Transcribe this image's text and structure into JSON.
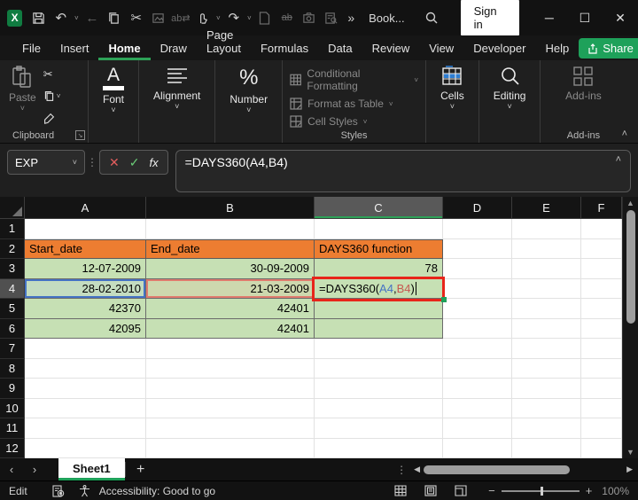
{
  "titlebar": {
    "title": "Book...",
    "sign_in": "Sign in",
    "overflow": "»"
  },
  "tabs": {
    "items": [
      "File",
      "Insert",
      "Home",
      "Draw",
      "Page Layout",
      "Formulas",
      "Data",
      "Review",
      "View",
      "Developer",
      "Help"
    ],
    "active": "Home",
    "share": "Share"
  },
  "ribbon": {
    "paste": "Paste",
    "clipboard_label": "Clipboard",
    "font_label": "Font",
    "alignment_label": "Alignment",
    "number_label": "Number",
    "conditional_formatting": "Conditional Formatting",
    "format_as_table": "Format as Table",
    "cell_styles": "Cell Styles",
    "styles_label": "Styles",
    "cells_label": "Cells",
    "editing_label": "Editing",
    "addins_button": "Add-ins",
    "addins_label": "Add-ins"
  },
  "formula_bar": {
    "name_box": "EXP",
    "formula": "=DAYS360(A4,B4)",
    "fx": "fx"
  },
  "grid": {
    "col_headers": [
      "A",
      "B",
      "C",
      "D",
      "E",
      "F"
    ],
    "row_headers": [
      "1",
      "2",
      "3",
      "4",
      "5",
      "6",
      "7",
      "8",
      "9",
      "10",
      "11",
      "12"
    ],
    "cells": {
      "a2": "Start_date",
      "b2": "End_date",
      "c2": "DAYS360 function",
      "a3": "12-07-2009",
      "b3": "30-09-2009",
      "c3": "78",
      "a4": "28-02-2010",
      "b4": "21-03-2009",
      "a5": "42370",
      "b5": "42401",
      "a6": "42095",
      "b6": "42401"
    },
    "formula_parts": {
      "fn": "=DAYS360(",
      "ref1": "A4",
      "sep": ",",
      "ref2": "B4",
      "close": ")"
    }
  },
  "sheetbar": {
    "sheet_name": "Sheet1",
    "add_sheet": "+"
  },
  "statusbar": {
    "mode": "Edit",
    "accessibility": "Accessibility: Good to go",
    "zoom_level": "100%"
  },
  "colors": {
    "accent_green": "#1EA15A",
    "header_orange": "#ED7D31",
    "cell_green": "#C6E0B4",
    "ref_blue": "#4472C4",
    "ref_red": "#C65951",
    "annotation_red": "#E8251A"
  }
}
